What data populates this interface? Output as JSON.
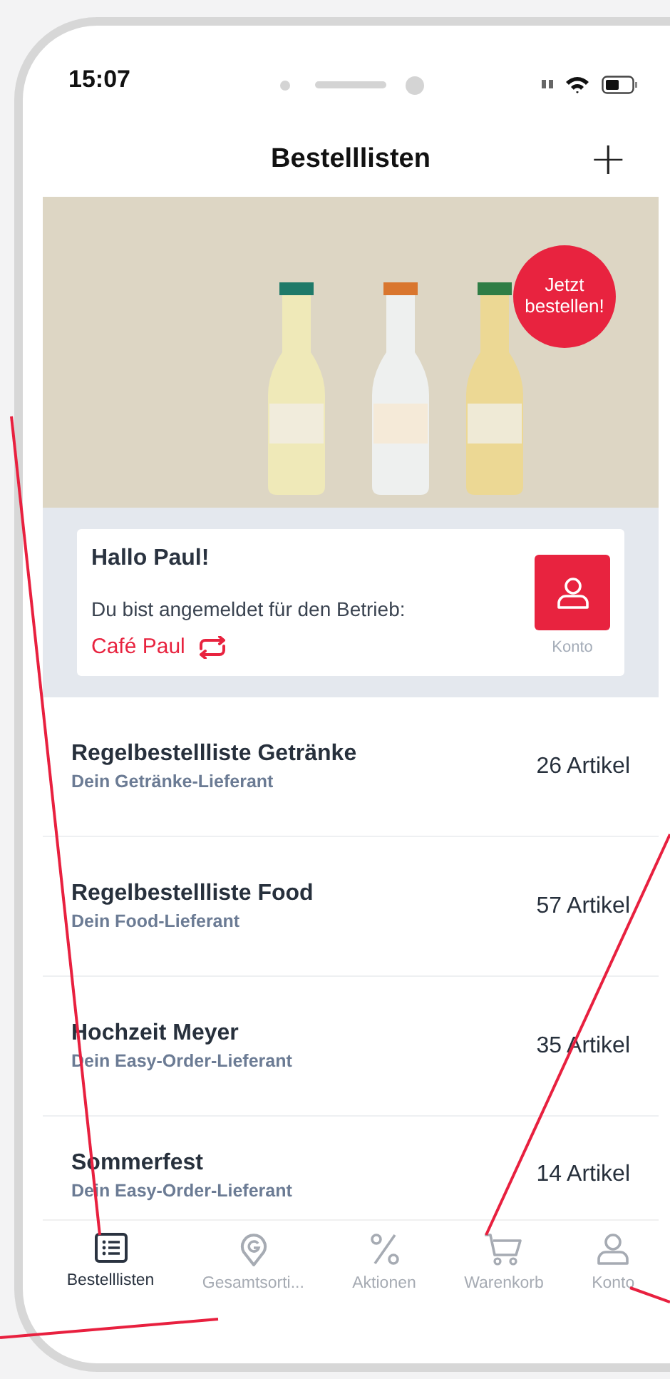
{
  "status_bar": {
    "time": "15:07"
  },
  "header": {
    "title": "Bestelllisten",
    "add_icon": "+"
  },
  "banner": {
    "badge": "Jetzt bestellen!"
  },
  "greeting": {
    "title": "Hallo Paul!",
    "text": "Du bist angemeldet für den Betrieb:",
    "business": "Café Paul",
    "account_label": "Konto"
  },
  "lists": [
    {
      "name": "Regelbestellliste Getränke",
      "supplier": "Dein Getränke-Lieferant",
      "count": "26 Artikel"
    },
    {
      "name": "Regelbestellliste Food",
      "supplier": "Dein Food-Lieferant",
      "count": "57 Artikel"
    },
    {
      "name": "Hochzeit Meyer",
      "supplier": "Dein Easy-Order-Lieferant",
      "count": "35 Artikel"
    },
    {
      "name": "Sommerfest",
      "supplier": "Dein Easy-Order-Lieferant",
      "count": "14 Artikel"
    }
  ],
  "tab_bar": [
    {
      "kind": "list",
      "label": "Bestelllisten",
      "selected": true
    },
    {
      "kind": "pin",
      "label": "Gesamtsorti...",
      "selected": false
    },
    {
      "kind": "percent",
      "label": "Aktionen",
      "selected": false
    },
    {
      "kind": "cart",
      "label": "Warenkorb",
      "selected": false
    },
    {
      "kind": "person",
      "label": "Konto",
      "selected": false
    }
  ]
}
